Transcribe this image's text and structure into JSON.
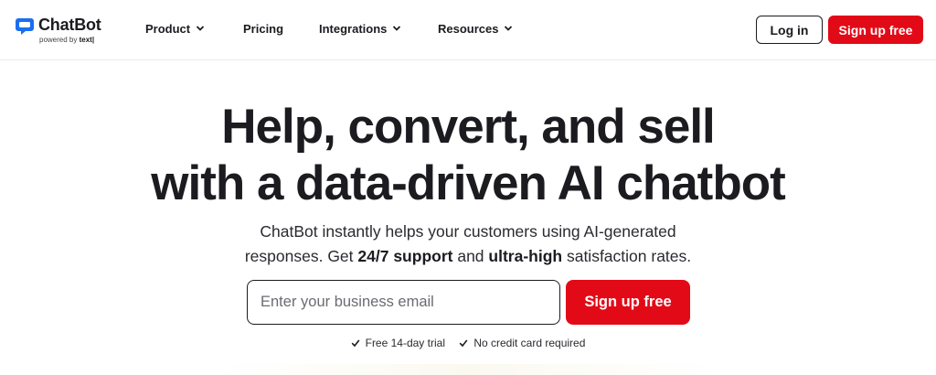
{
  "brand": {
    "name": "ChatBot",
    "powered_by": "powered by",
    "powered_by_brand": "text|",
    "logo_icon": "chat-bubble-icon",
    "accent_color": "#e30a17",
    "logo_color": "#1b6ef0"
  },
  "nav": {
    "items": [
      {
        "label": "Product",
        "has_dropdown": true
      },
      {
        "label": "Pricing",
        "has_dropdown": false
      },
      {
        "label": "Integrations",
        "has_dropdown": true
      },
      {
        "label": "Resources",
        "has_dropdown": true
      }
    ],
    "login_label": "Log in",
    "signup_label": "Sign up free"
  },
  "hero": {
    "title_line1": "Help, convert, and sell",
    "title_line2": "with a data-driven AI chatbot",
    "subtitle_part1": "ChatBot instantly helps your customers using AI-generated",
    "subtitle_part2": "responses. Get ",
    "subtitle_bold1": "24/7 support",
    "subtitle_part3": " and ",
    "subtitle_bold2": "ultra-high",
    "subtitle_part4": " satisfaction rates.",
    "email_placeholder": "Enter your business email",
    "email_value": "",
    "signup_label": "Sign up free",
    "perks": [
      "Free 14-day trial",
      "No credit card required"
    ]
  }
}
